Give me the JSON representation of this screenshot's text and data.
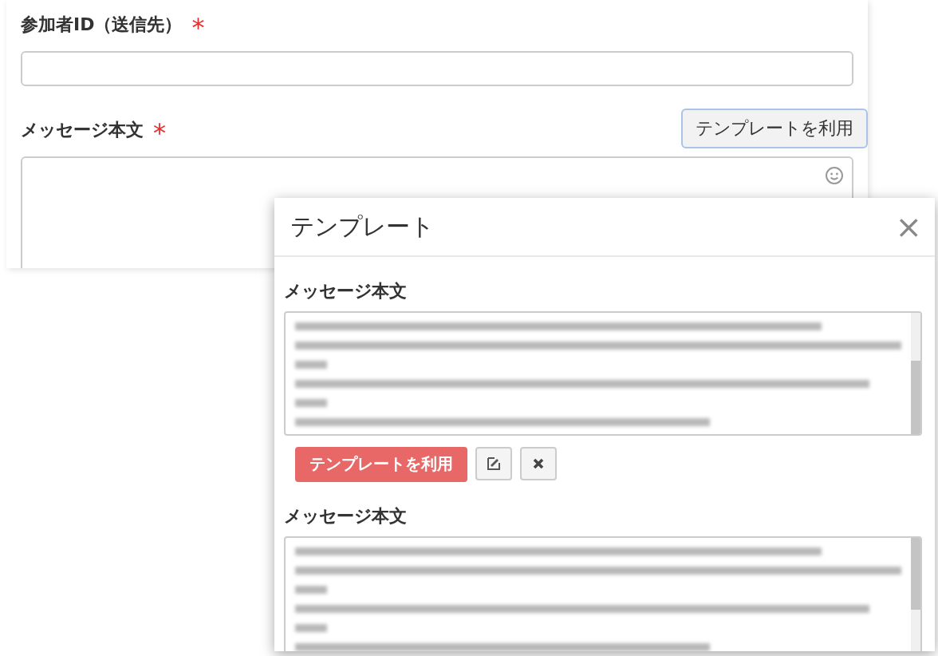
{
  "form": {
    "fields": [
      {
        "kind": "input",
        "label": "参加者ID（送信先）",
        "required_mark": "*"
      },
      {
        "kind": "textarea",
        "label": "メッセージ本文",
        "required_mark": "*",
        "button": "テンプレートを利用"
      }
    ]
  },
  "template_dialog": {
    "title": "テンプレート",
    "close": "×",
    "templates": [
      {
        "label": "メッセージ本文",
        "use_button": "テンプレートを利用"
      },
      {
        "label": "メッセージ本文"
      }
    ]
  }
}
